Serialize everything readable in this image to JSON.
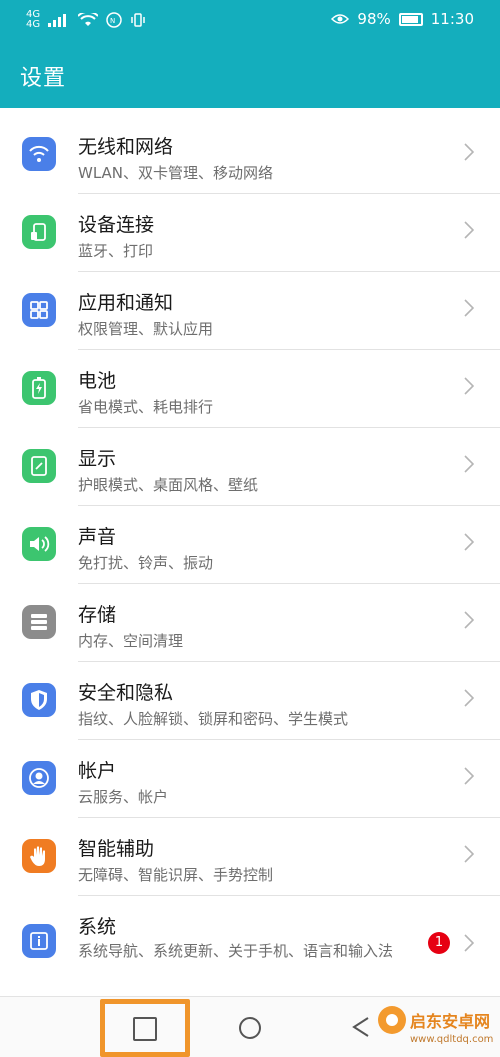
{
  "status_bar": {
    "network_left": "4G",
    "network_right": "4G",
    "battery": "98%",
    "time": "11:30"
  },
  "app_bar": {
    "title": "设置"
  },
  "settings": [
    {
      "title": "无线和网络",
      "subtitle": "WLAN、双卡管理、移动网络",
      "icon": "wifi-icon",
      "color": "#4a7fe8"
    },
    {
      "title": "设备连接",
      "subtitle": "蓝牙、打印",
      "icon": "device-connection-icon",
      "color": "#3cc56f"
    },
    {
      "title": "应用和通知",
      "subtitle": "权限管理、默认应用",
      "icon": "apps-grid-icon",
      "color": "#4a7fe8"
    },
    {
      "title": "电池",
      "subtitle": "省电模式、耗电排行",
      "icon": "battery-icon",
      "color": "#3cc56f"
    },
    {
      "title": "显示",
      "subtitle": "护眼模式、桌面风格、壁纸",
      "icon": "display-icon",
      "color": "#3cc56f"
    },
    {
      "title": "声音",
      "subtitle": "免打扰、铃声、振动",
      "icon": "speaker-icon",
      "color": "#3cc56f"
    },
    {
      "title": "存储",
      "subtitle": "内存、空间清理",
      "icon": "storage-icon",
      "color": "#8c8c8c"
    },
    {
      "title": "安全和隐私",
      "subtitle": "指纹、人脸解锁、锁屏和密码、学生模式",
      "icon": "shield-icon",
      "color": "#4a7fe8"
    },
    {
      "title": "帐户",
      "subtitle": "云服务、帐户",
      "icon": "account-icon",
      "color": "#4a7fe8"
    },
    {
      "title": "智能辅助",
      "subtitle": "无障碍、智能识屏、手势控制",
      "icon": "hand-icon",
      "color": "#f07c22"
    },
    {
      "title": "系统",
      "subtitle": "系统导航、系统更新、关于手机、语言和输入法",
      "icon": "info-icon",
      "color": "#4a7fe8",
      "badge": "1"
    }
  ],
  "watermark": {
    "text": "启东安卓网",
    "url": "www.qdltdq.com"
  }
}
